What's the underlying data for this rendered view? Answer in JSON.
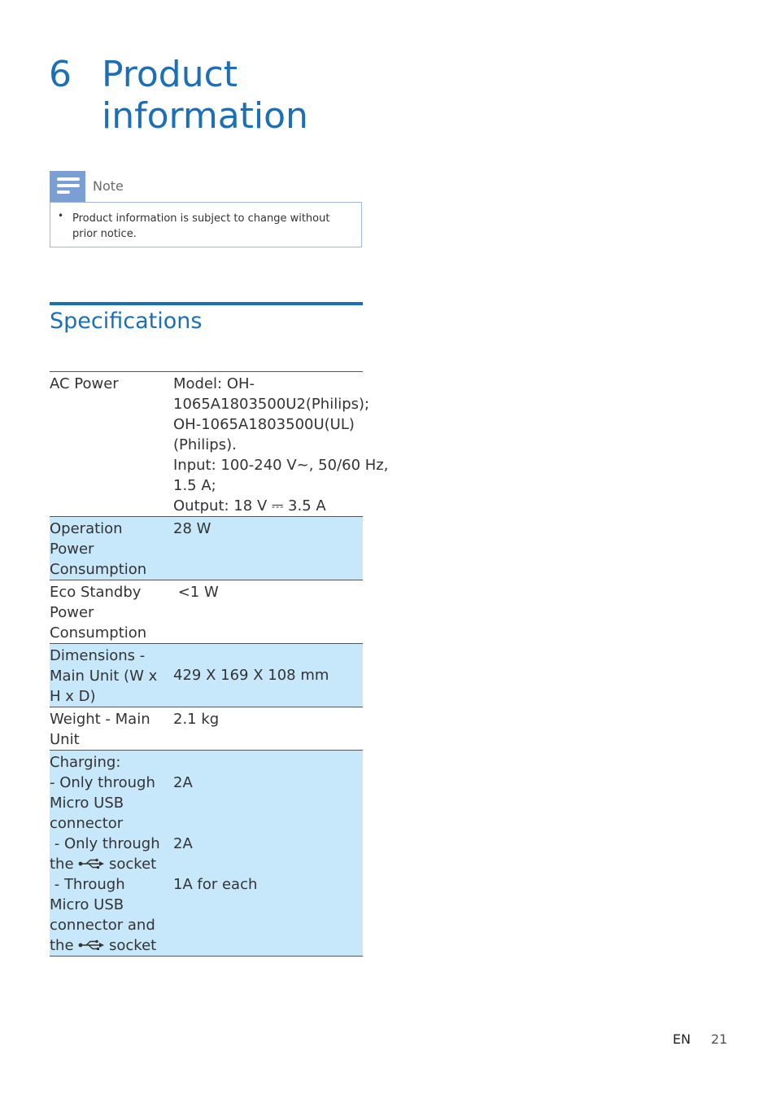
{
  "chapter": {
    "number": "6",
    "title_line1": "Product",
    "title_line2": "information"
  },
  "note": {
    "label": "Note",
    "icon": "note-icon",
    "bullet": "•",
    "text": "Product information is subject to change without prior notice."
  },
  "specs": {
    "heading": "Specifications",
    "rows": [
      {
        "label": [
          "AC Power"
        ],
        "value": [
          "Model: OH-",
          "1065A1803500U2(Philips);",
          "OH-1065A1803500U(UL)",
          "(Philips).",
          "Input: 100-240 V~, 50/60 Hz,",
          "1.5 A;",
          "Output: 18 V ⎓ 3.5 A"
        ]
      },
      {
        "label": [
          "Operation",
          "Power",
          "Consumption"
        ],
        "value": [
          "28 W"
        ]
      },
      {
        "label": [
          "Eco Standby",
          "Power",
          "Consumption"
        ],
        "value": [
          " <1 W"
        ]
      },
      {
        "label": [
          "Dimensions -",
          "Main Unit (W x",
          "H x D)"
        ],
        "value": [
          "429 X 169 X 108 mm"
        ]
      },
      {
        "label": [
          "Weight - Main",
          "Unit"
        ],
        "value": [
          "2.1 kg"
        ]
      },
      {
        "charging": {
          "line1": "Charging:",
          "opt1": [
            "- Only through",
            "Micro USB",
            "connector"
          ],
          "opt1_value": "2A",
          "opt2": [
            " - Only through"
          ],
          "opt2_prefix": "the",
          "opt2_suffix": "socket",
          "opt2_value": "2A",
          "opt3": [
            " - Through",
            "Micro USB",
            "connector and"
          ],
          "opt3_prefix": "the",
          "opt3_suffix": "socket",
          "opt3_value": "1A for each",
          "usb_icon": "usb-icon"
        }
      }
    ]
  },
  "footer": {
    "lang": "EN",
    "page": "21"
  }
}
